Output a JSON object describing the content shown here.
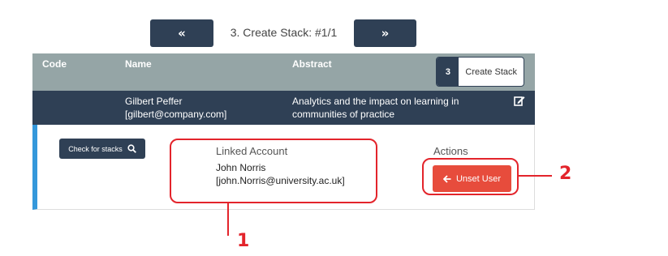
{
  "pager": {
    "prev_label": "«",
    "label": "3. Create Stack:  #1/1",
    "next_label": "»"
  },
  "table": {
    "headers": {
      "code": "Code",
      "name": "Name",
      "abstract": "Abstract"
    },
    "create_stack": {
      "count": "3",
      "label": "Create Stack"
    },
    "row": {
      "name_line1": "Gilbert Peffer",
      "name_line2": "[gilbert@company.com]",
      "abstract": "Analytics and the impact on learning in communities of practice",
      "edit_icon": "edit-icon"
    }
  },
  "detail": {
    "check_button": "Check for stacks",
    "check_icon": "search-icon",
    "linked_title": "Linked Account",
    "linked_name": "John Norris",
    "linked_email": "[john.Norris@university.ac.uk]",
    "actions_title": "Actions",
    "unset_button": "Unset User",
    "unset_icon": "arrow-left-icon"
  },
  "annotations": {
    "callout_1": "1",
    "callout_2": "2"
  },
  "colors": {
    "nav_dark": "#2f4055",
    "header_gray": "#95a5a6",
    "accent_blue": "#3498db",
    "danger_red": "#e74c3c",
    "callout_red": "#e3242b"
  }
}
